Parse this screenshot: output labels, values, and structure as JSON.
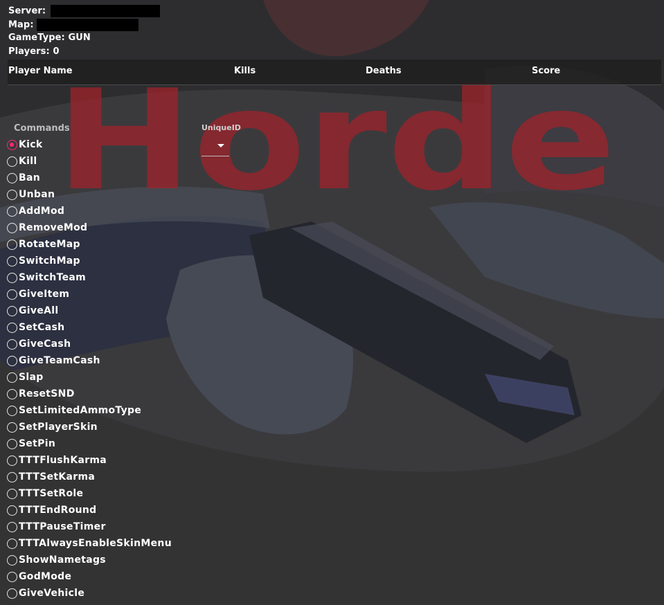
{
  "server": {
    "server_label": "Server:",
    "map_label": "Map:",
    "gametype_label": "GameType:",
    "gametype_value": "GUN",
    "players_label": "Players:",
    "players_value": "0"
  },
  "scoreboard": {
    "columns": [
      "Player Name",
      "Kills",
      "Deaths",
      "Score"
    ]
  },
  "background": {
    "logo_text": "Horde",
    "logo_color": "#a3222a"
  },
  "commands": {
    "title": "Commands",
    "selected": "Kick",
    "accent_color": "#ff2a6e",
    "items": [
      "Kick",
      "Kill",
      "Ban",
      "Unban",
      "AddMod",
      "RemoveMod",
      "RotateMap",
      "SwitchMap",
      "SwitchTeam",
      "GiveItem",
      "GiveAll",
      "SetCash",
      "GiveCash",
      "GiveTeamCash",
      "Slap",
      "ResetSND",
      "SetLimitedAmmoType",
      "SetPlayerSkin",
      "SetPin",
      "TTTFlushKarma",
      "TTTSetKarma",
      "TTTSetRole",
      "TTTEndRound",
      "TTTPauseTimer",
      "TTTAlwaysEnableSkinMenu",
      "ShowNametags",
      "GodMode",
      "GiveVehicle"
    ]
  },
  "uniqueid": {
    "label": "UniqueID",
    "value": ""
  }
}
